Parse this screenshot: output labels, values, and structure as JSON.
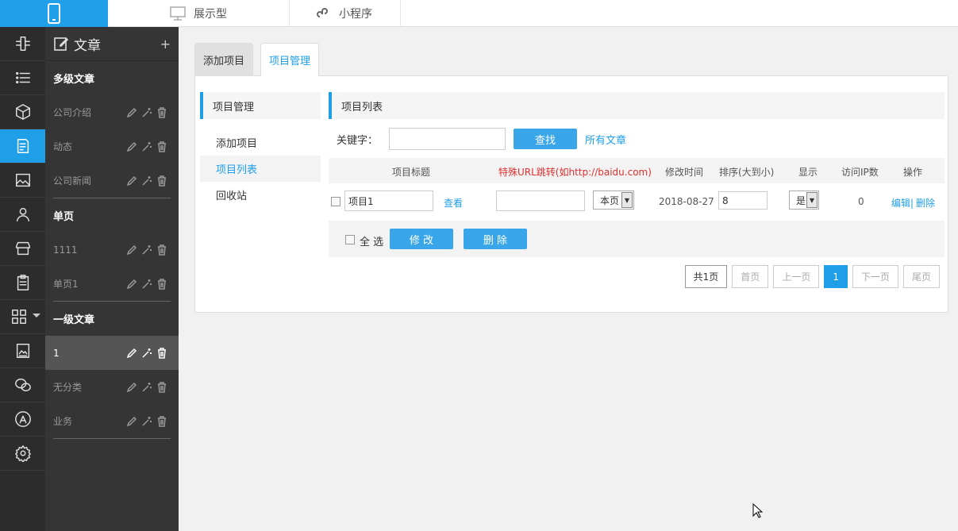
{
  "topbar": {
    "tabs": [
      {
        "label": "展示型",
        "icon": "monitor-icon"
      },
      {
        "label": "小程序",
        "icon": "mini-program-icon"
      }
    ]
  },
  "sidebar": {
    "title": "文章",
    "add": "+",
    "groups": [
      {
        "title": "多级文章",
        "items": [
          "公司介绍",
          "动态",
          "公司新闻"
        ]
      },
      {
        "title": "单页",
        "items": [
          "1111",
          "单页1"
        ]
      },
      {
        "title": "一级文章",
        "items": [
          "1",
          "无分类",
          "业务"
        ]
      }
    ]
  },
  "tabs": {
    "add": "添加项目",
    "manage": "项目管理"
  },
  "subnav": {
    "title": "项目管理",
    "items": [
      "添加项目",
      "项目列表",
      "回收站"
    ]
  },
  "content": {
    "title": "项目列表",
    "search": {
      "label": "关键字：",
      "value": "",
      "button": "查找",
      "all_link": "所有文章"
    },
    "columns": {
      "title": "项目标题",
      "url": "特殊URL跳转(如http://baidu.com)",
      "time": "修改时间",
      "sort": "排序(大到小)",
      "show": "显示",
      "ip": "访问IP数",
      "ops": "操作"
    },
    "row": {
      "title": "项目1",
      "view": "查看",
      "url": "",
      "target": "本页",
      "time": "2018-08-27",
      "sort": "8",
      "show": "是",
      "ip": "0",
      "edit": "编辑|",
      "delete": "删除"
    },
    "select_all": "全 选",
    "modify": "修 改",
    "remove": "删 除"
  },
  "pager": {
    "total": "共1页",
    "first": "首页",
    "prev": "上一页",
    "current": "1",
    "next": "下一页",
    "last": "尾页"
  },
  "colors": {
    "accent": "#1e9fe8",
    "url_header": "#e03030"
  }
}
